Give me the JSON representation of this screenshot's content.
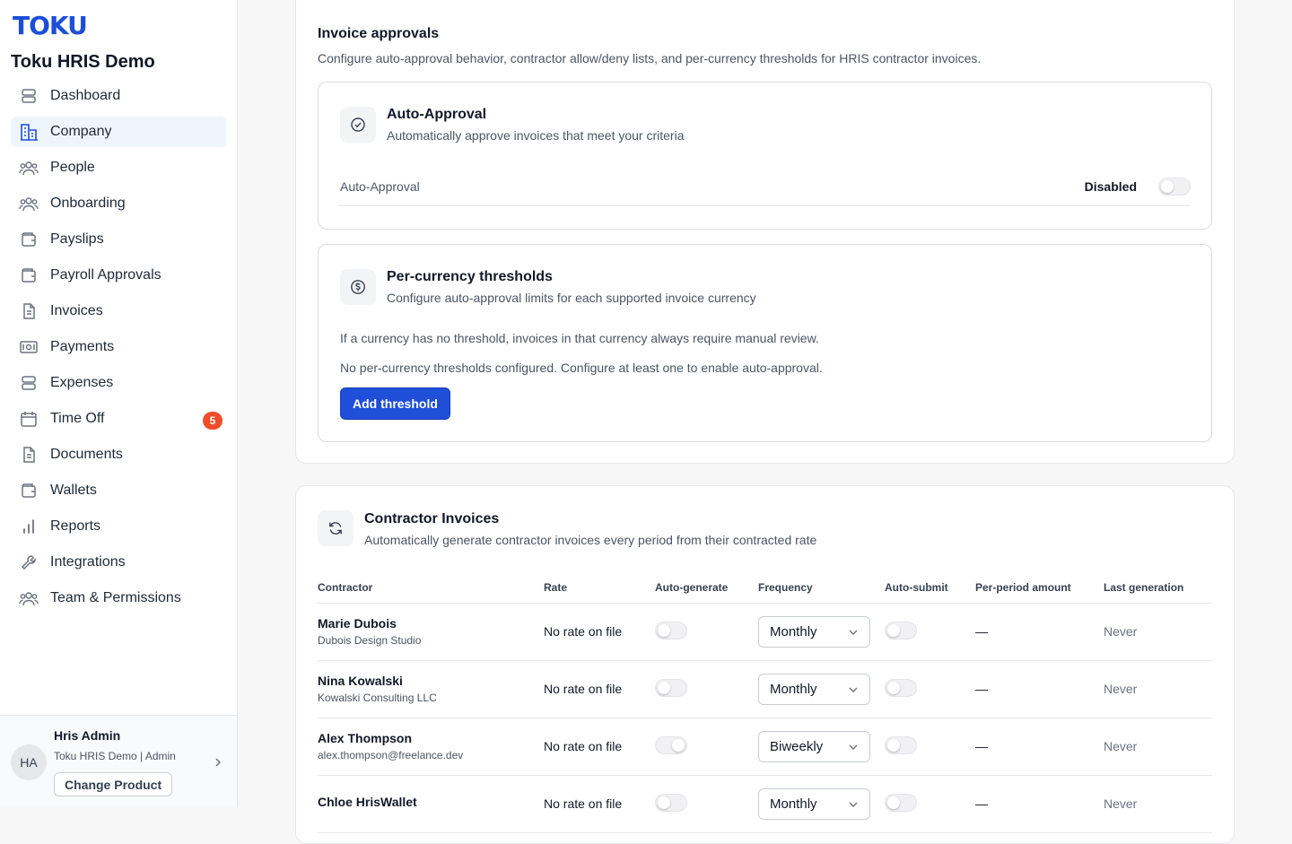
{
  "sidebar": {
    "logo": "TOKU",
    "org_name": "Toku HRIS Demo",
    "items": [
      {
        "label": "Dashboard",
        "icon": "dashboard-icon"
      },
      {
        "label": "Company",
        "icon": "building-icon",
        "active": true
      },
      {
        "label": "People",
        "icon": "people-icon"
      },
      {
        "label": "Onboarding",
        "icon": "onboarding-icon"
      },
      {
        "label": "Payslips",
        "icon": "wallet-icon"
      },
      {
        "label": "Payroll Approvals",
        "icon": "wallet-icon"
      },
      {
        "label": "Invoices",
        "icon": "document-icon"
      },
      {
        "label": "Payments",
        "icon": "payments-icon"
      },
      {
        "label": "Expenses",
        "icon": "stack-icon"
      },
      {
        "label": "Time Off",
        "icon": "calendar-icon",
        "badge": "5"
      },
      {
        "label": "Documents",
        "icon": "document-icon"
      },
      {
        "label": "Wallets",
        "icon": "wallet-icon"
      },
      {
        "label": "Reports",
        "icon": "bar-chart-icon"
      },
      {
        "label": "Integrations",
        "icon": "wrench-icon"
      },
      {
        "label": "Team & Permissions",
        "icon": "people-icon"
      }
    ],
    "user": {
      "initials": "HA",
      "name": "Hris Admin",
      "subtitle": "Toku HRIS Demo | Admin",
      "change_product": "Change Product"
    }
  },
  "invoice_approvals": {
    "title": "Invoice approvals",
    "description": "Configure auto-approval behavior, contractor allow/deny lists, and per-currency thresholds for HRIS contractor invoices.",
    "auto_approval": {
      "title": "Auto-Approval",
      "subtitle": "Automatically approve invoices that meet your criteria",
      "row_label": "Auto-Approval",
      "status": "Disabled"
    },
    "thresholds": {
      "title": "Per-currency thresholds",
      "subtitle": "Configure auto-approval limits for each supported invoice currency",
      "note": "If a currency has no threshold, invoices in that currency always require manual review.",
      "empty": "No per-currency thresholds configured. Configure at least one to enable auto-approval.",
      "add_button": "Add threshold"
    }
  },
  "contractor_invoices": {
    "title": "Contractor Invoices",
    "subtitle": "Automatically generate contractor invoices every period from their contracted rate",
    "columns": [
      "Contractor",
      "Rate",
      "Auto-generate",
      "Frequency",
      "Auto-submit",
      "Per-period amount",
      "Last generation"
    ],
    "rows": [
      {
        "name": "Marie Dubois",
        "sub": "Dubois Design Studio",
        "rate": "No rate on file",
        "auto_generate": false,
        "frequency": "Monthly",
        "auto_submit": false,
        "amount": "—",
        "last": "Never"
      },
      {
        "name": "Nina Kowalski",
        "sub": "Kowalski Consulting LLC",
        "rate": "No rate on file",
        "auto_generate": false,
        "frequency": "Monthly",
        "auto_submit": false,
        "amount": "—",
        "last": "Never"
      },
      {
        "name": "Alex Thompson",
        "sub": "alex.thompson@freelance.dev",
        "rate": "No rate on file",
        "auto_generate": true,
        "frequency": "Biweekly",
        "auto_submit": false,
        "amount": "—",
        "last": "Never"
      },
      {
        "name": "Chloe HrisWallet",
        "sub": "",
        "rate": "No rate on file",
        "auto_generate": false,
        "frequency": "Monthly",
        "auto_submit": false,
        "amount": "—",
        "last": "Never"
      }
    ]
  },
  "colors": {
    "accent": "#1f4fd8",
    "logo": "#1d4ed8",
    "badge": "#f04d2a",
    "active_nav": "#eff5fd"
  }
}
